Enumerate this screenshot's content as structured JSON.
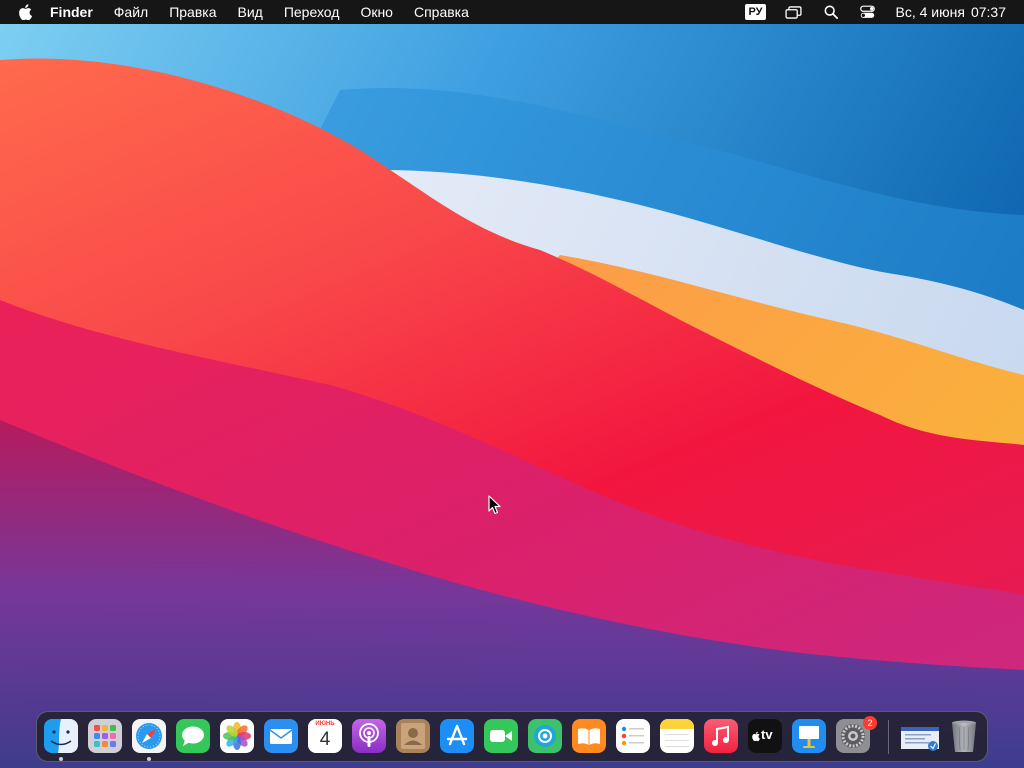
{
  "menubar": {
    "app_name": "Finder",
    "menus": [
      "Файл",
      "Правка",
      "Вид",
      "Переход",
      "Окно",
      "Справка"
    ],
    "status": {
      "input_language": "РУ",
      "date": "Вс, 4 июня",
      "time": "07:37"
    },
    "icons": [
      "apple-logo",
      "screen-mirroring-icon",
      "search-icon",
      "control-center-icon"
    ]
  },
  "dock": {
    "apps": [
      {
        "name": "finder",
        "running": true
      },
      {
        "name": "launchpad",
        "running": false
      },
      {
        "name": "safari",
        "running": true
      },
      {
        "name": "messages",
        "running": false
      },
      {
        "name": "photos",
        "running": false
      },
      {
        "name": "mail",
        "running": false
      },
      {
        "name": "calendar",
        "running": false
      },
      {
        "name": "podcasts",
        "running": false
      },
      {
        "name": "contacts",
        "running": false
      },
      {
        "name": "app-store",
        "running": false
      },
      {
        "name": "facetime",
        "running": false
      },
      {
        "name": "find-my",
        "running": false
      },
      {
        "name": "books",
        "running": false
      },
      {
        "name": "reminders",
        "running": false
      },
      {
        "name": "notes",
        "running": false
      },
      {
        "name": "music",
        "running": false
      },
      {
        "name": "apple-tv",
        "running": false
      },
      {
        "name": "keynote",
        "running": false
      },
      {
        "name": "system-preferences",
        "running": false
      }
    ],
    "calendar": {
      "month": "ИЮНЬ",
      "day": "4"
    },
    "system_preferences_badge": "2",
    "apple_tv_label": "tv",
    "trailing": [
      {
        "name": "downloads-stack"
      },
      {
        "name": "trash"
      }
    ]
  },
  "colors": {
    "menubar_bg": "#161616",
    "wallpaper_red": "#f2163f",
    "wallpaper_orange": "#f9a13b",
    "wallpaper_blue": "#1d7bc4",
    "wallpaper_purple": "#6a3aa0"
  }
}
